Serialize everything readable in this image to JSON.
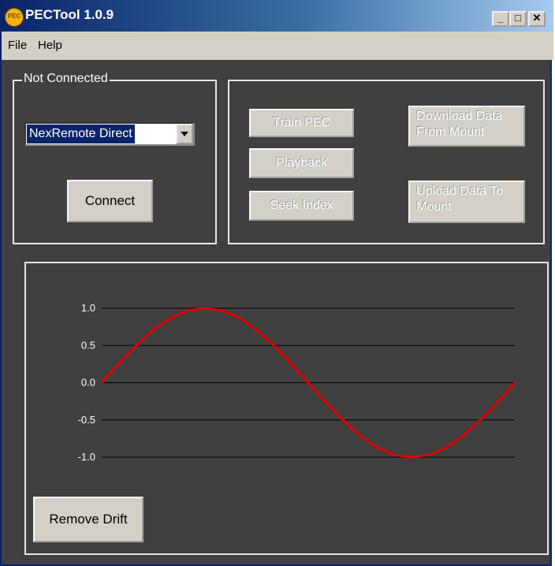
{
  "window": {
    "title": "PECTool 1.0.9",
    "icon": "pec-logo-icon",
    "controls": {
      "minimize": "_",
      "maximize": "□",
      "close": "✕"
    }
  },
  "menu": {
    "file": "File",
    "help": "Help"
  },
  "connection": {
    "group_label": "Not Connected",
    "selected_device": "NexRemote Direct",
    "connect_label": "Connect"
  },
  "actions": {
    "train_pec": "Train PEC",
    "playback": "Playback",
    "seek_index": "Seek Index",
    "download_line1": "Download Data",
    "download_line2": "From Mount",
    "upload_line1": "Upload Data To",
    "upload_line2": "Mount"
  },
  "remove_drift_label": "Remove Drift",
  "colors": {
    "background": "#404040",
    "curve": "#e00000",
    "title_bar": "#0a246a",
    "button_face": "#d4d0c8"
  },
  "chart_data": {
    "type": "line",
    "title": "",
    "xlabel": "",
    "ylabel": "",
    "ylim": [
      -1.0,
      1.0
    ],
    "yticks": [
      "1.0",
      "0.5",
      "0.0",
      "-0.5",
      "-1.0"
    ],
    "grid": true,
    "legend": "none",
    "x": [
      0,
      15,
      30,
      45,
      60,
      75,
      90,
      105,
      120,
      135,
      150,
      165,
      180,
      195,
      210,
      225,
      240,
      255,
      270,
      285,
      300,
      315,
      330,
      345,
      360
    ],
    "series": [
      {
        "values": [
          0.0,
          0.26,
          0.5,
          0.71,
          0.87,
          0.97,
          1.0,
          0.97,
          0.87,
          0.71,
          0.5,
          0.26,
          0.0,
          -0.26,
          -0.5,
          -0.71,
          -0.87,
          -0.97,
          -1.0,
          -0.97,
          -0.87,
          -0.71,
          -0.5,
          -0.26,
          0.0
        ]
      }
    ]
  }
}
